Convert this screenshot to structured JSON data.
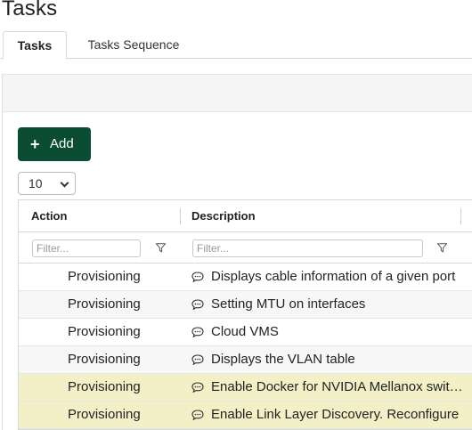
{
  "page": {
    "title": "Tasks"
  },
  "tabs": [
    {
      "label": "Tasks",
      "active": true
    },
    {
      "label": "Tasks Sequence",
      "active": false
    }
  ],
  "toolbar": {
    "add_label": "Add"
  },
  "pagination": {
    "page_size": "10"
  },
  "grid": {
    "columns": [
      {
        "header": "Action",
        "filter_placeholder": "Filter..."
      },
      {
        "header": "Description",
        "filter_placeholder": "Filter..."
      }
    ],
    "rows": [
      {
        "action": "Provisioning",
        "description": "Displays cable information of a given port",
        "style": "normal"
      },
      {
        "action": "Provisioning",
        "description": "Setting MTU on interfaces",
        "style": "alt"
      },
      {
        "action": "Provisioning",
        "description": "Cloud VMS",
        "style": "normal"
      },
      {
        "action": "Provisioning",
        "description": "Displays the VLAN table",
        "style": "alt"
      },
      {
        "action": "Provisioning",
        "description": "Enable Docker for NVIDIA Mellanox switches",
        "style": "highlight"
      },
      {
        "action": "Provisioning",
        "description": "Enable Link Layer Discovery. Reconfigure",
        "style": "highlight"
      }
    ]
  },
  "colors": {
    "primary_button": "#0b4d32",
    "row_highlight": "#f3f0c8",
    "row_alt": "#f7f7f7"
  }
}
